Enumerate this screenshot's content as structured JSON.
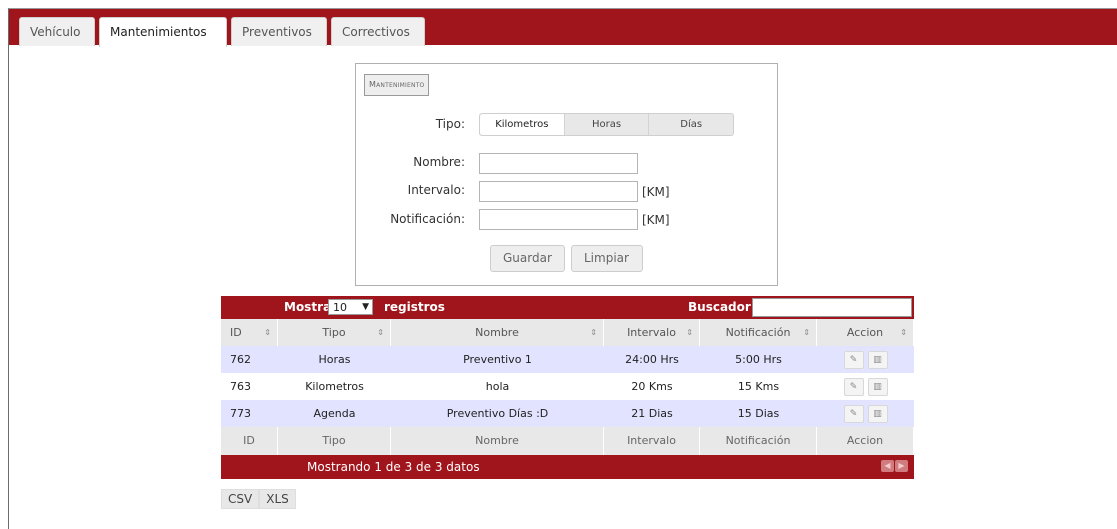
{
  "tabs": [
    {
      "label": "Vehículo",
      "active": false
    },
    {
      "label": "Mantenimientos",
      "active": true
    },
    {
      "label": "Preventivos",
      "active": false
    },
    {
      "label": "Correctivos",
      "active": false
    }
  ],
  "form": {
    "legend": "Mantenimiento",
    "tipo_label": "Tipo:",
    "tipo_options": [
      "Kilometros",
      "Horas",
      "Días"
    ],
    "tipo_selected": "Kilometros",
    "nombre_label": "Nombre:",
    "nombre_value": "",
    "intervalo_label": "Intervalo:",
    "intervalo_value": "",
    "intervalo_unit": "[KM]",
    "notificacion_label": "Notificación:",
    "notificacion_value": "",
    "notificacion_unit": "[KM]",
    "save_label": "Guardar",
    "clear_label": "Limpiar"
  },
  "table": {
    "show_label": "Mostrar",
    "page_size": "10",
    "records_label": "registros",
    "search_label": "Buscador:",
    "search_value": "",
    "columns": [
      "ID",
      "Tipo",
      "Nombre",
      "Intervalo",
      "Notificación",
      "Accion"
    ],
    "rows": [
      {
        "id": "762",
        "tipo": "Horas",
        "nombre": "Preventivo 1",
        "intervalo": "24:00 Hrs",
        "notificacion": "5:00 Hrs"
      },
      {
        "id": "763",
        "tipo": "Kilometros",
        "nombre": "hola",
        "intervalo": "20 Kms",
        "notificacion": "15 Kms"
      },
      {
        "id": "773",
        "tipo": "Agenda",
        "nombre": "Preventivo Días :D",
        "intervalo": "21 Dias",
        "notificacion": "15 Dias"
      }
    ],
    "info": "Mostrando 1 de 3 de 3 datos"
  },
  "export": {
    "csv": "CSV",
    "xls": "XLS"
  },
  "colors": {
    "brand": "#a0141b",
    "row_odd": "#e2e4ff"
  },
  "icons": {
    "edit": "pencil-icon",
    "delete": "trash-icon",
    "sort": "sort-arrows-icon",
    "prev": "prev-page-icon",
    "next": "next-page-icon"
  }
}
